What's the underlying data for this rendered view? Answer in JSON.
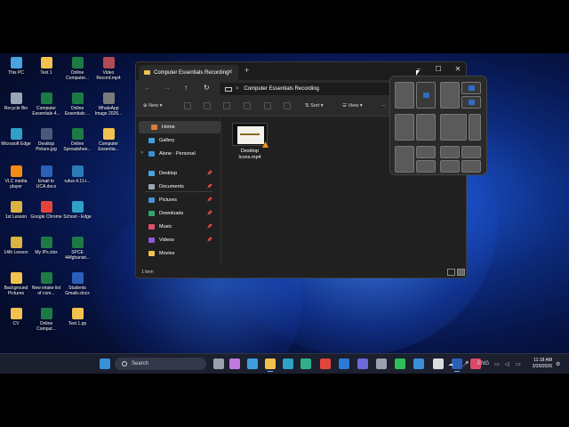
{
  "desktop_icons": [
    {
      "label": "This PC",
      "color": "#4aa3df"
    },
    {
      "label": "Test 1",
      "color": "#f2c14e"
    },
    {
      "label": "Online Computer...",
      "color": "#1d7a44"
    },
    {
      "label": "Video Record.mp4",
      "color": "#b04a55"
    },
    {
      "label": "Recycle Bin",
      "color": "#9aa6b5"
    },
    {
      "label": "Computer Essentials 4...",
      "color": "#1d7a44"
    },
    {
      "label": "Online Essentials ...",
      "color": "#1d7a44"
    },
    {
      "label": "WhatsApp Image 2026...",
      "color": "#7b7b7b"
    },
    {
      "label": "Microsoft Edge",
      "color": "#2fa0c8"
    },
    {
      "label": "Desktop Picture.jpg",
      "color": "#4a5a7a"
    },
    {
      "label": "Online Spreadshee...",
      "color": "#1d7a44"
    },
    {
      "label": "Computer Essentia...",
      "color": "#f2c14e"
    },
    {
      "label": "VLC media player",
      "color": "#f28b14"
    },
    {
      "label": "Email to UCA.docx",
      "color": "#2b5fb8"
    },
    {
      "label": "rufus-4.11-i...",
      "color": "#2a7ab8"
    },
    {
      "label": "1st Lesson",
      "color": "#d9b440"
    },
    {
      "label": "Google Chrome",
      "color": "#e2463a"
    },
    {
      "label": "School - Edge",
      "color": "#2fa0c8"
    },
    {
      "label": "14th Lesson",
      "color": "#d9b440"
    },
    {
      "label": "My IPs.xlsx",
      "color": "#1d7a44"
    },
    {
      "label": "SPCE 4Afghanist...",
      "color": "#1d7a44"
    },
    {
      "label": "Background Pictures",
      "color": "#f2c14e"
    },
    {
      "label": "New intake list of com...",
      "color": "#1d7a44"
    },
    {
      "label": "Students Gmails.docx",
      "color": "#2b5fb8"
    },
    {
      "label": "CV",
      "color": "#f2c14e"
    },
    {
      "label": "Online Comput...",
      "color": "#1d7a44"
    },
    {
      "label": "Test 1.pp",
      "color": "#f2c14e"
    }
  ],
  "explorer": {
    "tab_title": "Computer Essentials Recording",
    "tab_close": "✕",
    "new_tab": "+",
    "minimize": "–",
    "maximize": "☐",
    "close": "✕",
    "nav": {
      "back": "←",
      "forward": "→",
      "up": "↑",
      "refresh": "↻"
    },
    "address_chevron": ">",
    "address": "Computer Essentials Recording",
    "commands": {
      "new": "New",
      "sort": "Sort",
      "view": "View",
      "more": "···"
    },
    "sidebar": [
      {
        "label": "Home",
        "icon": "home-icon",
        "color": "#e07b39",
        "pinned": false
      },
      {
        "label": "Gallery",
        "icon": "gallery-icon",
        "color": "#3fa0e0",
        "pinned": false
      },
      {
        "label": "Alone - Personal",
        "icon": "cloud-icon",
        "color": "#3a8fd9",
        "pinned": false
      },
      {
        "label": "Desktop",
        "icon": "desktop-icon",
        "color": "#4aa3df",
        "pinned": true
      },
      {
        "label": "Documents",
        "icon": "documents-icon",
        "color": "#9aa6b5",
        "pinned": true
      },
      {
        "label": "Pictures",
        "icon": "pictures-icon",
        "color": "#4a90d9",
        "pinned": true
      },
      {
        "label": "Downloads",
        "icon": "downloads-icon",
        "color": "#2fa870",
        "pinned": true
      },
      {
        "label": "Music",
        "icon": "music-icon",
        "color": "#e0506a",
        "pinned": true
      },
      {
        "label": "Videos",
        "icon": "videos-icon",
        "color": "#8a5ad9",
        "pinned": true
      },
      {
        "label": "Movies",
        "icon": "folder-icon",
        "color": "#f2c14e",
        "pinned": false
      }
    ],
    "pin_glyph": "📌",
    "expand_glyph": ">",
    "file": {
      "name": "Desktop Icons.mp4"
    },
    "status": "1 item"
  },
  "taskbar": {
    "search_label": "Search",
    "language": "ENG",
    "time": "11:18 AM",
    "date": "2/20/2026",
    "apps": [
      {
        "name": "task-view-icon",
        "color": "#9aa0b0"
      },
      {
        "name": "copilot-icon",
        "color": "#c07ae0"
      },
      {
        "name": "store-icon",
        "color": "#3fa0e0"
      },
      {
        "name": "file-explorer-icon",
        "color": "#f2c14e"
      },
      {
        "name": "photos-icon",
        "color": "#2fa0c8"
      },
      {
        "name": "edge-icon",
        "color": "#2fb08a"
      },
      {
        "name": "chrome-icon",
        "color": "#e2463a"
      },
      {
        "name": "outlook-icon",
        "color": "#2b7ad9"
      },
      {
        "name": "teams-icon",
        "color": "#6a6ad9"
      },
      {
        "name": "settings-icon",
        "color": "#9aa0b0"
      },
      {
        "name": "whatsapp-icon",
        "color": "#2fbf5a"
      },
      {
        "name": "vpn-icon",
        "color": "#3a8fd9"
      },
      {
        "name": "chatgpt-icon",
        "color": "#dcdcdc"
      },
      {
        "name": "word-icon",
        "color": "#2b5fb8"
      },
      {
        "name": "snipping-tool-icon",
        "color": "#d94a6a"
      }
    ]
  }
}
